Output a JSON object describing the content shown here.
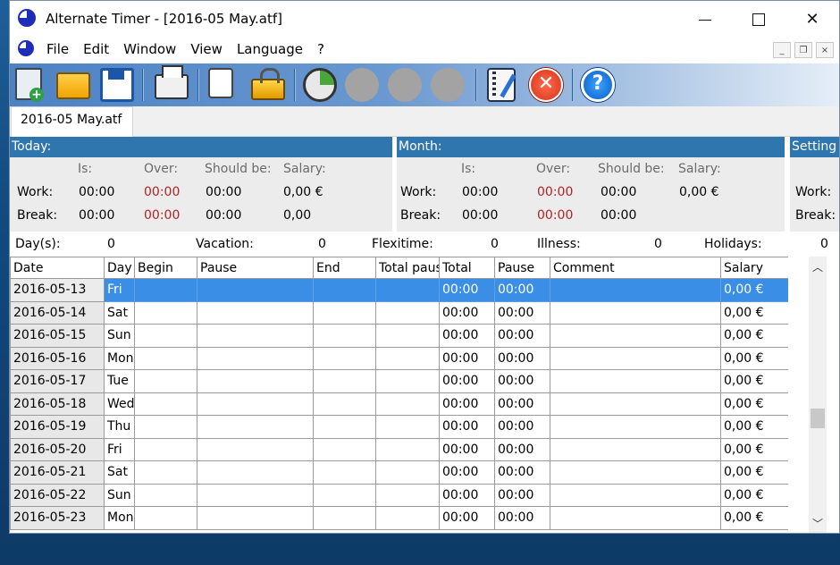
{
  "window": {
    "title": "Alternate Timer - [2016-05 May.atf]"
  },
  "menu": {
    "items": [
      "File",
      "Edit",
      "Window",
      "View",
      "Language",
      "?"
    ]
  },
  "mdi": {
    "minimize": "_",
    "restore": "❐",
    "close": "×"
  },
  "tab": {
    "label": "2016-05 May.atf"
  },
  "today": {
    "header": "Today:",
    "cols": {
      "is": "Is:",
      "over": "Over:",
      "should": "Should be:",
      "salary": "Salary:"
    },
    "work": {
      "label": "Work:",
      "is": "00:00",
      "over": "00:00",
      "should": "00:00",
      "salary": "0,00 €"
    },
    "break": {
      "label": "Break:",
      "is": "00:00",
      "over": "00:00",
      "should": "00:00",
      "salary": "0,00"
    }
  },
  "month": {
    "header": "Month:",
    "cols": {
      "is": "Is:",
      "over": "Over:",
      "should": "Should be:",
      "salary": "Salary:"
    },
    "work": {
      "label": "Work:",
      "is": "00:00",
      "over": "00:00",
      "should": "00:00",
      "salary": "0,00 €"
    },
    "break": {
      "label": "Break:",
      "is": "00:00",
      "over": "00:00",
      "should": "00:00"
    }
  },
  "settings": {
    "header": "Setting",
    "work": "Work:",
    "break": "Break:"
  },
  "counts": {
    "days_label": "Day(s):",
    "days": "0",
    "vacation_label": "Vacation:",
    "vacation": "0",
    "flexitime_label": "Flexitime:",
    "flexitime": "0",
    "illness_label": "Illness:",
    "illness": "0",
    "holidays_label": "Holidays:",
    "holidays": "0"
  },
  "table": {
    "headers": [
      "Date",
      "Day",
      "Begin",
      "Pause",
      "End",
      "Total pause",
      "Total",
      "Pause",
      "Comment",
      "Salary"
    ],
    "rows": [
      [
        "2016-05-13",
        "Fri",
        "",
        "",
        "",
        "",
        "00:00",
        "00:00",
        "",
        "0,00 €"
      ],
      [
        "2016-05-14",
        "Sat",
        "",
        "",
        "",
        "",
        "00:00",
        "00:00",
        "",
        "0,00 €"
      ],
      [
        "2016-05-15",
        "Sun",
        "",
        "",
        "",
        "",
        "00:00",
        "00:00",
        "",
        "0,00 €"
      ],
      [
        "2016-05-16",
        "Mon",
        "",
        "",
        "",
        "",
        "00:00",
        "00:00",
        "",
        "0,00 €"
      ],
      [
        "2016-05-17",
        "Tue",
        "",
        "",
        "",
        "",
        "00:00",
        "00:00",
        "",
        "0,00 €"
      ],
      [
        "2016-05-18",
        "Wed",
        "",
        "",
        "",
        "",
        "00:00",
        "00:00",
        "",
        "0,00 €"
      ],
      [
        "2016-05-19",
        "Thu",
        "",
        "",
        "",
        "",
        "00:00",
        "00:00",
        "",
        "0,00 €"
      ],
      [
        "2016-05-20",
        "Fri",
        "",
        "",
        "",
        "",
        "00:00",
        "00:00",
        "",
        "0,00 €"
      ],
      [
        "2016-05-21",
        "Sat",
        "",
        "",
        "",
        "",
        "00:00",
        "00:00",
        "",
        "0,00 €"
      ],
      [
        "2016-05-22",
        "Sun",
        "",
        "",
        "",
        "",
        "00:00",
        "00:00",
        "",
        "0,00 €"
      ],
      [
        "2016-05-23",
        "Mon",
        "",
        "",
        "",
        "",
        "00:00",
        "00:00",
        "",
        "0,00 €"
      ]
    ],
    "selected_row": 0
  },
  "icons": {
    "toolbar": [
      "new-document-icon",
      "open-folder-icon",
      "save-icon",
      "print-icon",
      "copy-icon",
      "lock-icon",
      "clock-icon",
      "gray-circle-icon",
      "gray-circle-icon",
      "gray-circle-icon",
      "notepad-icon",
      "cancel-icon",
      "help-icon"
    ]
  },
  "colors": {
    "panel_header": "#2f76ae",
    "selection": "#3a8ee6",
    "over_value": "#b22222"
  }
}
